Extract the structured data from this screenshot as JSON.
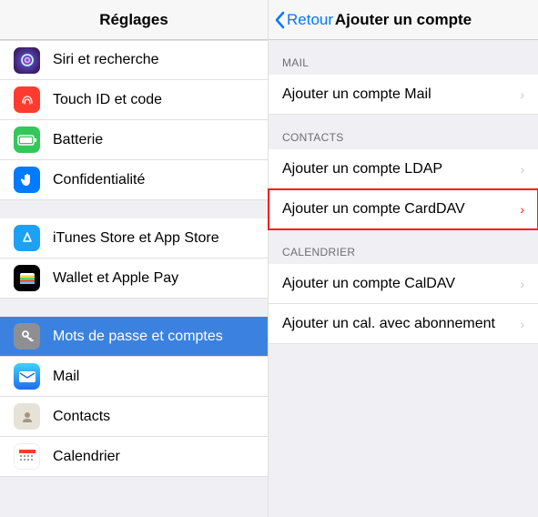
{
  "left": {
    "title": "Réglages",
    "groups": [
      {
        "items": [
          {
            "id": "siri",
            "label": "Siri et recherche"
          },
          {
            "id": "touchid",
            "label": "Touch ID et code"
          },
          {
            "id": "battery",
            "label": "Batterie"
          },
          {
            "id": "privacy",
            "label": "Confidentialité"
          }
        ]
      },
      {
        "items": [
          {
            "id": "itunes",
            "label": "iTunes Store et App Store"
          },
          {
            "id": "wallet",
            "label": "Wallet et Apple Pay"
          }
        ]
      },
      {
        "items": [
          {
            "id": "passwords",
            "label": "Mots de passe et comptes",
            "selected": true
          },
          {
            "id": "mail",
            "label": "Mail"
          },
          {
            "id": "contacts",
            "label": "Contacts"
          },
          {
            "id": "calendar",
            "label": "Calendrier"
          }
        ]
      }
    ]
  },
  "right": {
    "back": "Retour",
    "title": "Ajouter un compte",
    "sections": [
      {
        "header": "MAIL",
        "items": [
          {
            "id": "add-mail",
            "label": "Ajouter un compte Mail"
          }
        ]
      },
      {
        "header": "CONTACTS",
        "items": [
          {
            "id": "add-ldap",
            "label": "Ajouter un compte LDAP"
          },
          {
            "id": "add-carddav",
            "label": "Ajouter un compte CardDAV",
            "highlight": true
          }
        ]
      },
      {
        "header": "CALENDRIER",
        "items": [
          {
            "id": "add-caldav",
            "label": "Ajouter un compte CalDAV"
          },
          {
            "id": "add-subscribe",
            "label": "Ajouter un cal. avec abonnement"
          }
        ]
      }
    ]
  }
}
